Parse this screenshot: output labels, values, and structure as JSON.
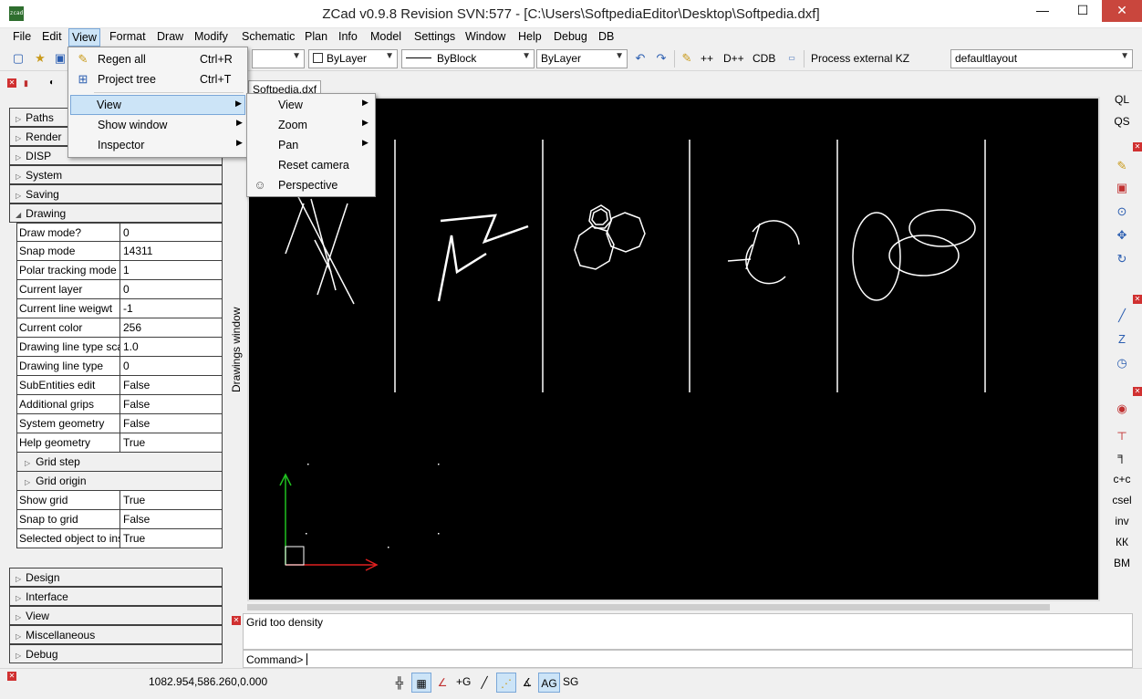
{
  "titlebar": {
    "app_icon": "zcad",
    "title": "ZCad v0.9.8 Revision SVN:577 - [C:\\Users\\SoftpediaEditor\\Desktop\\Softpedia.dxf]",
    "minimize": "—",
    "maximize": "☐",
    "close": "✕"
  },
  "menubar": {
    "items": [
      "File",
      "Edit",
      "View",
      "Format",
      "Draw",
      "Modify",
      "Schematic",
      "Plan",
      "Info",
      "Model",
      "Settings",
      "Window",
      "Help",
      "Debug",
      "DB"
    ]
  },
  "toolbar": {
    "layer_combo": "ByLayer",
    "linetype_combo": "ByBlock",
    "lineweight_combo": "ByLayer",
    "plus_plus": "++",
    "d_plus_plus": "D++",
    "cdb": "CDB",
    "process_label": "Process external KZ",
    "layout_combo": "defaultlayout"
  },
  "view_menu": {
    "items": [
      {
        "label": "Regen all",
        "shortcut": "Ctrl+R",
        "icon": "regen-icon"
      },
      {
        "label": "Project tree",
        "shortcut": "Ctrl+T",
        "icon": "project-tree-icon"
      },
      {
        "label": "View",
        "submenu": true
      },
      {
        "label": "Show window",
        "submenu": true
      },
      {
        "label": "Inspector",
        "submenu": true
      }
    ]
  },
  "view_submenu": {
    "items": [
      {
        "label": "View"
      },
      {
        "label": "Zoom"
      },
      {
        "label": "Pan"
      },
      {
        "label": "Reset camera"
      },
      {
        "label": "Perspective"
      }
    ]
  },
  "tree": {
    "top_headers": [
      "Paths",
      "Render",
      "DISP",
      "System",
      "Saving",
      "Drawing"
    ],
    "drawing_props": [
      {
        "k": "Draw mode?",
        "v": "0"
      },
      {
        "k": "Snap mode",
        "v": "14311"
      },
      {
        "k": "Polar tracking mode",
        "v": "1"
      },
      {
        "k": "Current layer",
        "v": "0"
      },
      {
        "k": "Current line weigwt",
        "v": "-1"
      },
      {
        "k": "Current color",
        "v": "256"
      },
      {
        "k": "Drawing line type sca",
        "v": "1.0"
      },
      {
        "k": "Drawing line type",
        "v": "0"
      },
      {
        "k": "SubEntities edit",
        "v": "False"
      },
      {
        "k": "Additional grips",
        "v": "False"
      },
      {
        "k": "System geometry",
        "v": "False"
      },
      {
        "k": "Help geometry",
        "v": "True"
      }
    ],
    "grid_step": "Grid step",
    "grid_origin": "Grid origin",
    "grid_props": [
      {
        "k": "Show grid",
        "v": "True"
      },
      {
        "k": "Snap to grid",
        "v": "False"
      },
      {
        "k": "Selected object to ins",
        "v": "True"
      }
    ],
    "bottom_headers": [
      "Design",
      "Interface",
      "View",
      "Miscellaneous",
      "Debug"
    ]
  },
  "drawings_window_label": "Drawings window",
  "doc_tab": "Softpedia.dxf",
  "right_toolbar": {
    "ql": "QL",
    "qs": "QS",
    "cc": "c+c",
    "csel": "csel",
    "inv": "inv",
    "kk": "КК",
    "bm": "BM"
  },
  "messages": {
    "text": "Grid too density",
    "command_label": "Command>"
  },
  "statusbar": {
    "coords": "1082.954,586.260,0.000",
    "plus_g": "+G",
    "ag": "AG",
    "sg": "SG"
  },
  "colors": {
    "canvas_bg": "#000000",
    "axis_x": "#e02020",
    "axis_y": "#20c020",
    "menu_highlight": "#cce4f7"
  }
}
